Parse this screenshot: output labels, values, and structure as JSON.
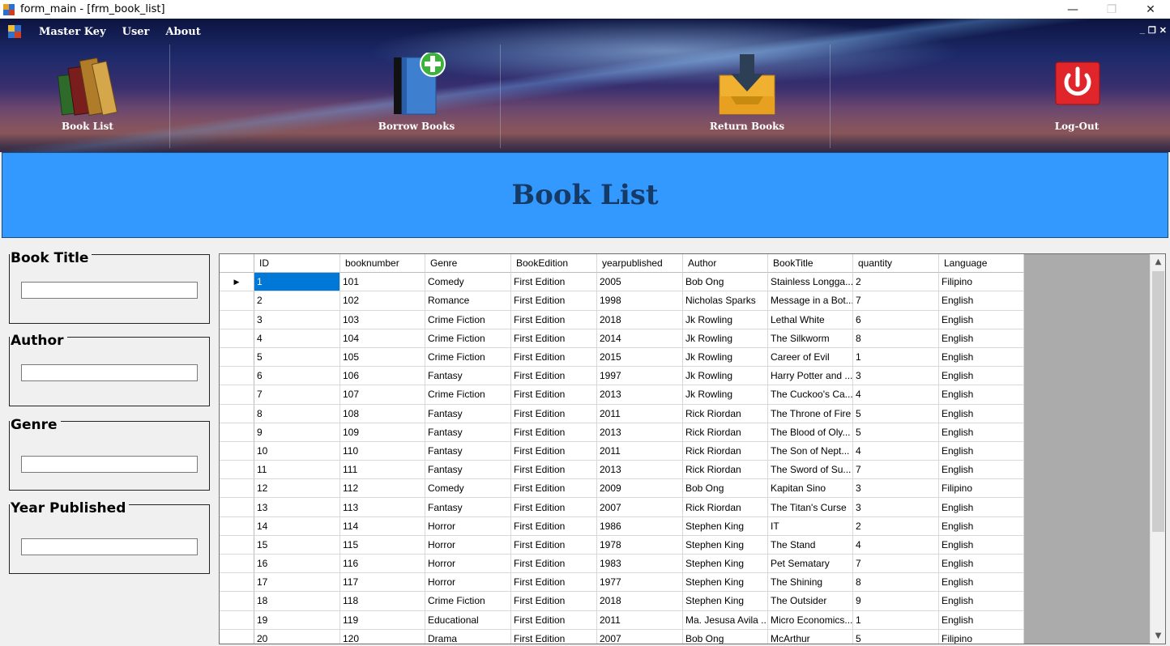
{
  "window": {
    "title": "form_main - [frm_book_list]",
    "minimize": "—",
    "restore": "❐",
    "close": "✕"
  },
  "menu": {
    "items": [
      "Master Key",
      "User",
      "About"
    ],
    "mdi_minimize": "_",
    "mdi_restore": "❐",
    "mdi_close": "✕"
  },
  "toolbar": {
    "book_list": "Book List",
    "borrow_books": "Borrow Books",
    "return_books": "Return Books",
    "log_out": "Log-Out"
  },
  "header": {
    "title": "Book List"
  },
  "search": {
    "book_title": {
      "label": "Book Title",
      "value": ""
    },
    "author": {
      "label": "Author",
      "value": ""
    },
    "genre": {
      "label": "Genre",
      "value": ""
    },
    "year_published": {
      "label": "Year Published",
      "value": ""
    }
  },
  "grid": {
    "columns": [
      "ID",
      "booknumber",
      "Genre",
      "BookEdition",
      "yearpublished",
      "Author",
      "BookTitle",
      "quantity",
      "Language"
    ],
    "current_row_marker": "▶",
    "selected_row": 0,
    "rows": [
      [
        "1",
        "101",
        "Comedy",
        "First Edition",
        "2005",
        "Bob Ong",
        "Stainless Longga...",
        "2",
        "Filipino"
      ],
      [
        "2",
        "102",
        "Romance",
        "First Edition",
        "1998",
        "Nicholas Sparks",
        "Message in a Bot...",
        "7",
        "English"
      ],
      [
        "3",
        "103",
        "Crime Fiction",
        "First Edition",
        "2018",
        "Jk Rowling",
        "Lethal White",
        "6",
        "English"
      ],
      [
        "4",
        "104",
        "Crime Fiction",
        "First Edition",
        "2014",
        "Jk Rowling",
        "The Silkworm",
        "8",
        "English"
      ],
      [
        "5",
        "105",
        "Crime Fiction",
        "First Edition",
        "2015",
        "Jk Rowling",
        "Career of Evil",
        "1",
        "English"
      ],
      [
        "6",
        "106",
        "Fantasy",
        "First Edition",
        "1997",
        "Jk Rowling",
        "Harry Potter and ...",
        "3",
        "English"
      ],
      [
        "7",
        "107",
        "Crime Fiction",
        "First Edition",
        "2013",
        "Jk Rowling",
        "The Cuckoo's Ca...",
        "4",
        "English"
      ],
      [
        "8",
        "108",
        "Fantasy",
        "First Edition",
        "2011",
        "Rick Riordan",
        "The Throne of Fire",
        "5",
        "English"
      ],
      [
        "9",
        "109",
        "Fantasy",
        "First Edition",
        "2013",
        "Rick Riordan",
        "The Blood of Oly...",
        "5",
        "English"
      ],
      [
        "10",
        "110",
        "Fantasy",
        "First Edition",
        "2011",
        "Rick Riordan",
        "The Son of Nept...",
        "4",
        "English"
      ],
      [
        "11",
        "111",
        "Fantasy",
        "First Edition",
        "2013",
        "Rick Riordan",
        "The Sword of Su...",
        "7",
        "English"
      ],
      [
        "12",
        "112",
        "Comedy",
        "First Edition",
        "2009",
        "Bob Ong",
        "Kapitan Sino",
        "3",
        "Filipino"
      ],
      [
        "13",
        "113",
        "Fantasy",
        "First Edition",
        "2007",
        "Rick Riordan",
        "The Titan's Curse",
        "3",
        "English"
      ],
      [
        "14",
        "114",
        "Horror",
        "First Edition",
        "1986",
        "Stephen King",
        "IT",
        "2",
        "English"
      ],
      [
        "15",
        "115",
        "Horror",
        "First Edition",
        "1978",
        "Stephen King",
        "The Stand",
        "4",
        "English"
      ],
      [
        "16",
        "116",
        "Horror",
        "First Edition",
        "1983",
        "Stephen King",
        "Pet Sematary",
        "7",
        "English"
      ],
      [
        "17",
        "117",
        "Horror",
        "First Edition",
        "1977",
        "Stephen King",
        "The Shining",
        "8",
        "English"
      ],
      [
        "18",
        "118",
        "Crime Fiction",
        "First Edition",
        "2018",
        "Stephen King",
        "The Outsider",
        "9",
        "English"
      ],
      [
        "19",
        "119",
        "Educational",
        "First Edition",
        "2011",
        "Ma. Jesusa Avila ...",
        "Micro Economics...",
        "1",
        "English"
      ],
      [
        "20",
        "120",
        "Drama",
        "First Edition",
        "2007",
        "Bob Ong",
        "McArthur",
        "5",
        "Filipino"
      ]
    ]
  },
  "scrollbar": {
    "up": "▲",
    "down": "▼"
  },
  "colors": {
    "header_panel": "#3399ff",
    "header_title": "#163a66",
    "selection": "#0078d7",
    "grid_background": "#ababab",
    "power_button": "#e0262a"
  },
  "icons": {
    "app": "app-icon",
    "book_list": "books-stack-icon",
    "borrow_books": "book-add-icon",
    "return_books": "tray-download-icon",
    "log_out": "power-icon"
  }
}
